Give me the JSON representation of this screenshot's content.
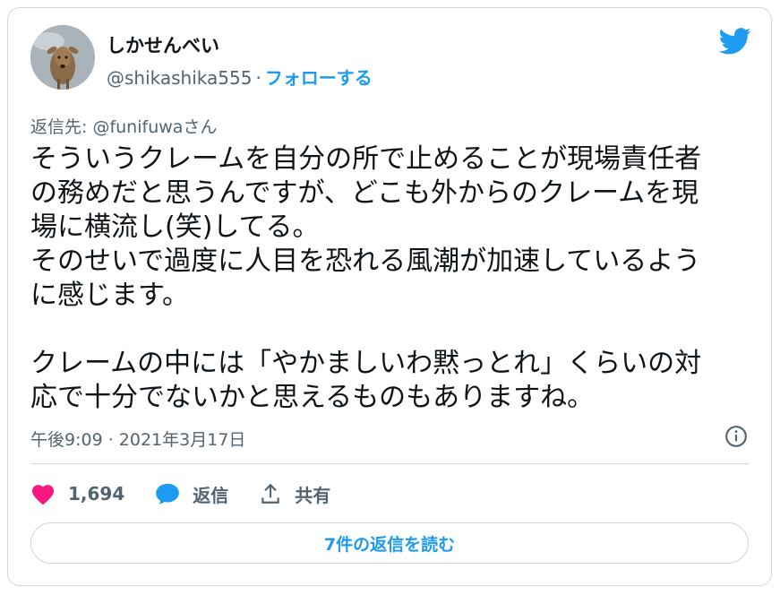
{
  "user": {
    "name": "しかせんべい",
    "handle": "@shikashika555",
    "separator": "·",
    "follow_label": "フォローする"
  },
  "reply": {
    "prefix": "返信先: ",
    "mention": "@funifuwa",
    "suffix": "さん"
  },
  "tweet": {
    "text": "そういうクレームを自分の所で止めることが現場責任者\nの務めだと思うんですが、どこも外からのクレームを現\n場に横流し(笑)してる。\nそのせいで過度に人目を恐れる風潮が加速しているよう\nに感じます。\n\nクレームの中には「やかましいわ黙っとれ」くらいの対\n応で十分でないかと思えるものもありますね。",
    "timestamp": "午後9:09 · 2021年3月17日"
  },
  "actions": {
    "like_count": "1,694",
    "reply_label": "返信",
    "share_label": "共有"
  },
  "footer": {
    "read_replies_label": "7件の返信を読む"
  },
  "icons": {
    "brand": "twitter-bird-icon",
    "info": "info-icon",
    "like": "heart-icon",
    "reply": "reply-bubble-icon",
    "share": "share-upload-icon"
  },
  "colors": {
    "accent": "#1d9bf0",
    "like": "#f91880",
    "muted": "#536471",
    "text": "#0f1419",
    "border": "#cfd9de"
  }
}
